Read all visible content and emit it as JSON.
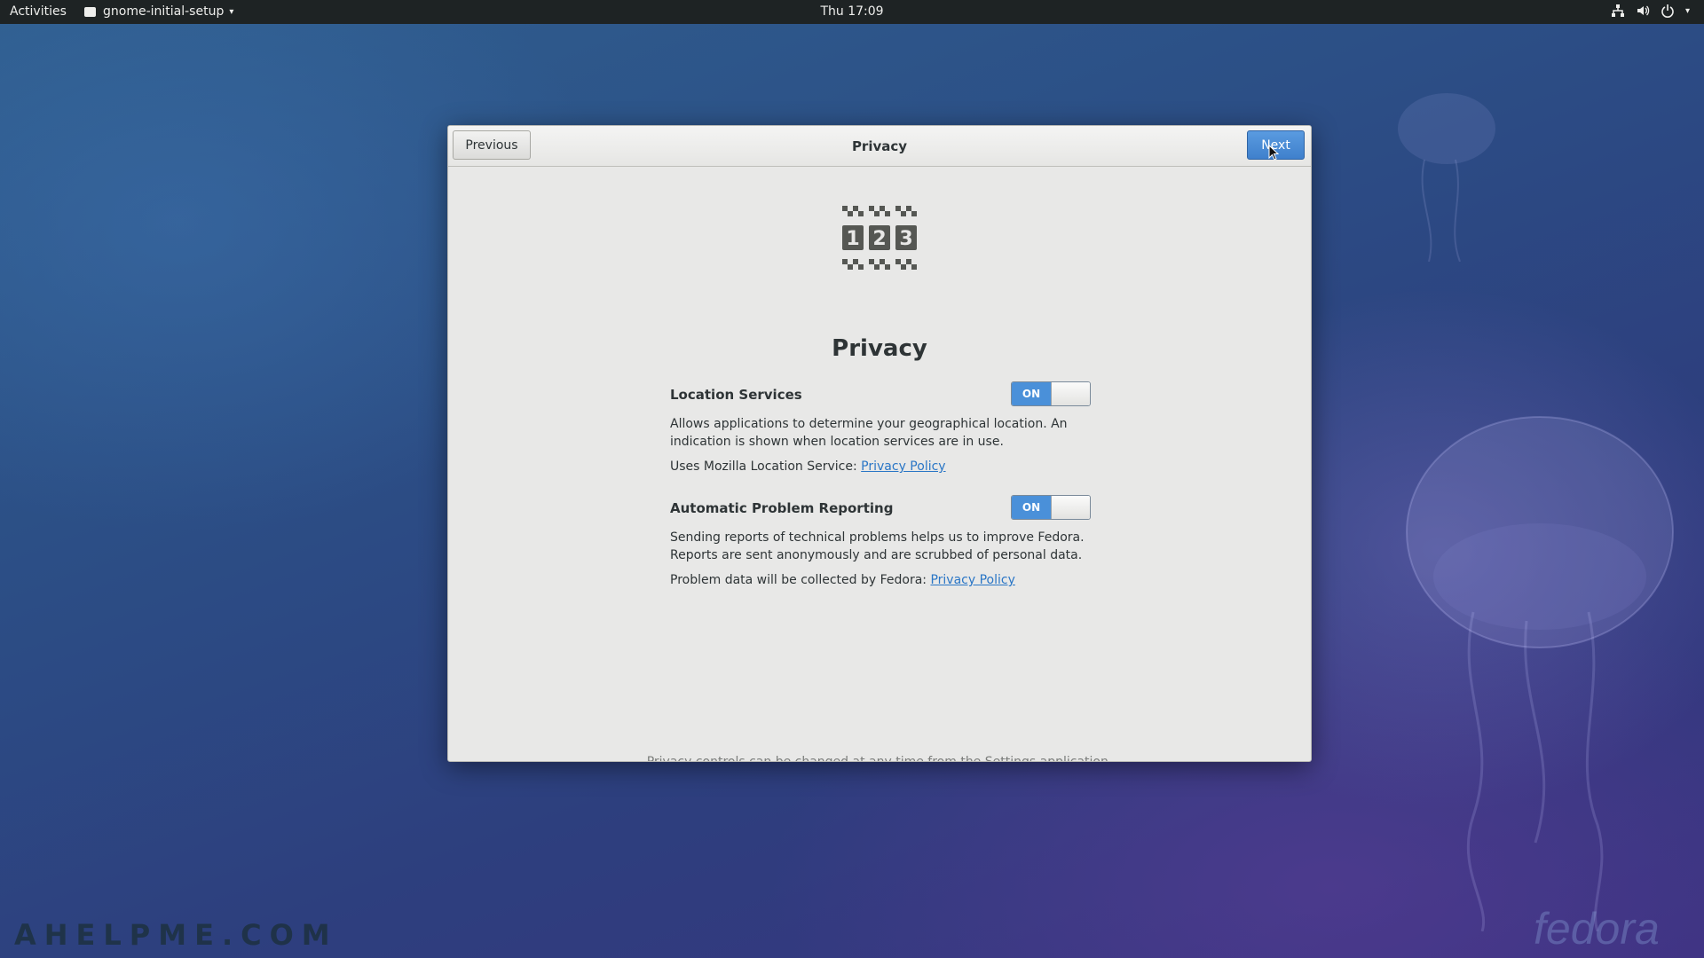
{
  "topbar": {
    "activities": "Activities",
    "app_menu": "gnome-initial-setup",
    "clock": "Thu 17:09",
    "status_icons": [
      "network-wired-icon",
      "volume-icon",
      "power-icon",
      "chevron-down-icon"
    ]
  },
  "dialog": {
    "header_title": "Privacy",
    "previous_label": "Previous",
    "next_label": "Next",
    "page_title": "Privacy",
    "hero_icon": "privacy-123-checker-icon",
    "sections": [
      {
        "heading": "Location Services",
        "switch_label": "ON",
        "switch_state": true,
        "description": "Allows applications to determine your geographical location. An indication is shown when location services are in use.",
        "policy_prefix": "Uses Mozilla Location Service:",
        "policy_link": "Privacy Policy"
      },
      {
        "heading": "Automatic Problem Reporting",
        "switch_label": "ON",
        "switch_state": true,
        "description": "Sending reports of technical problems helps us to improve Fedora. Reports are sent anonymously and are scrubbed of personal data.",
        "policy_prefix": "Problem data will be collected by Fedora:",
        "policy_link": "Privacy Policy"
      }
    ],
    "footer_note": "Privacy controls can be changed at any time from the Settings application."
  },
  "watermarks": {
    "left": "AHELPME.COM",
    "right": "fedora"
  },
  "colors": {
    "accent": "#4a90d9",
    "link": "#2a76c6",
    "topbar": "#1e2324"
  }
}
